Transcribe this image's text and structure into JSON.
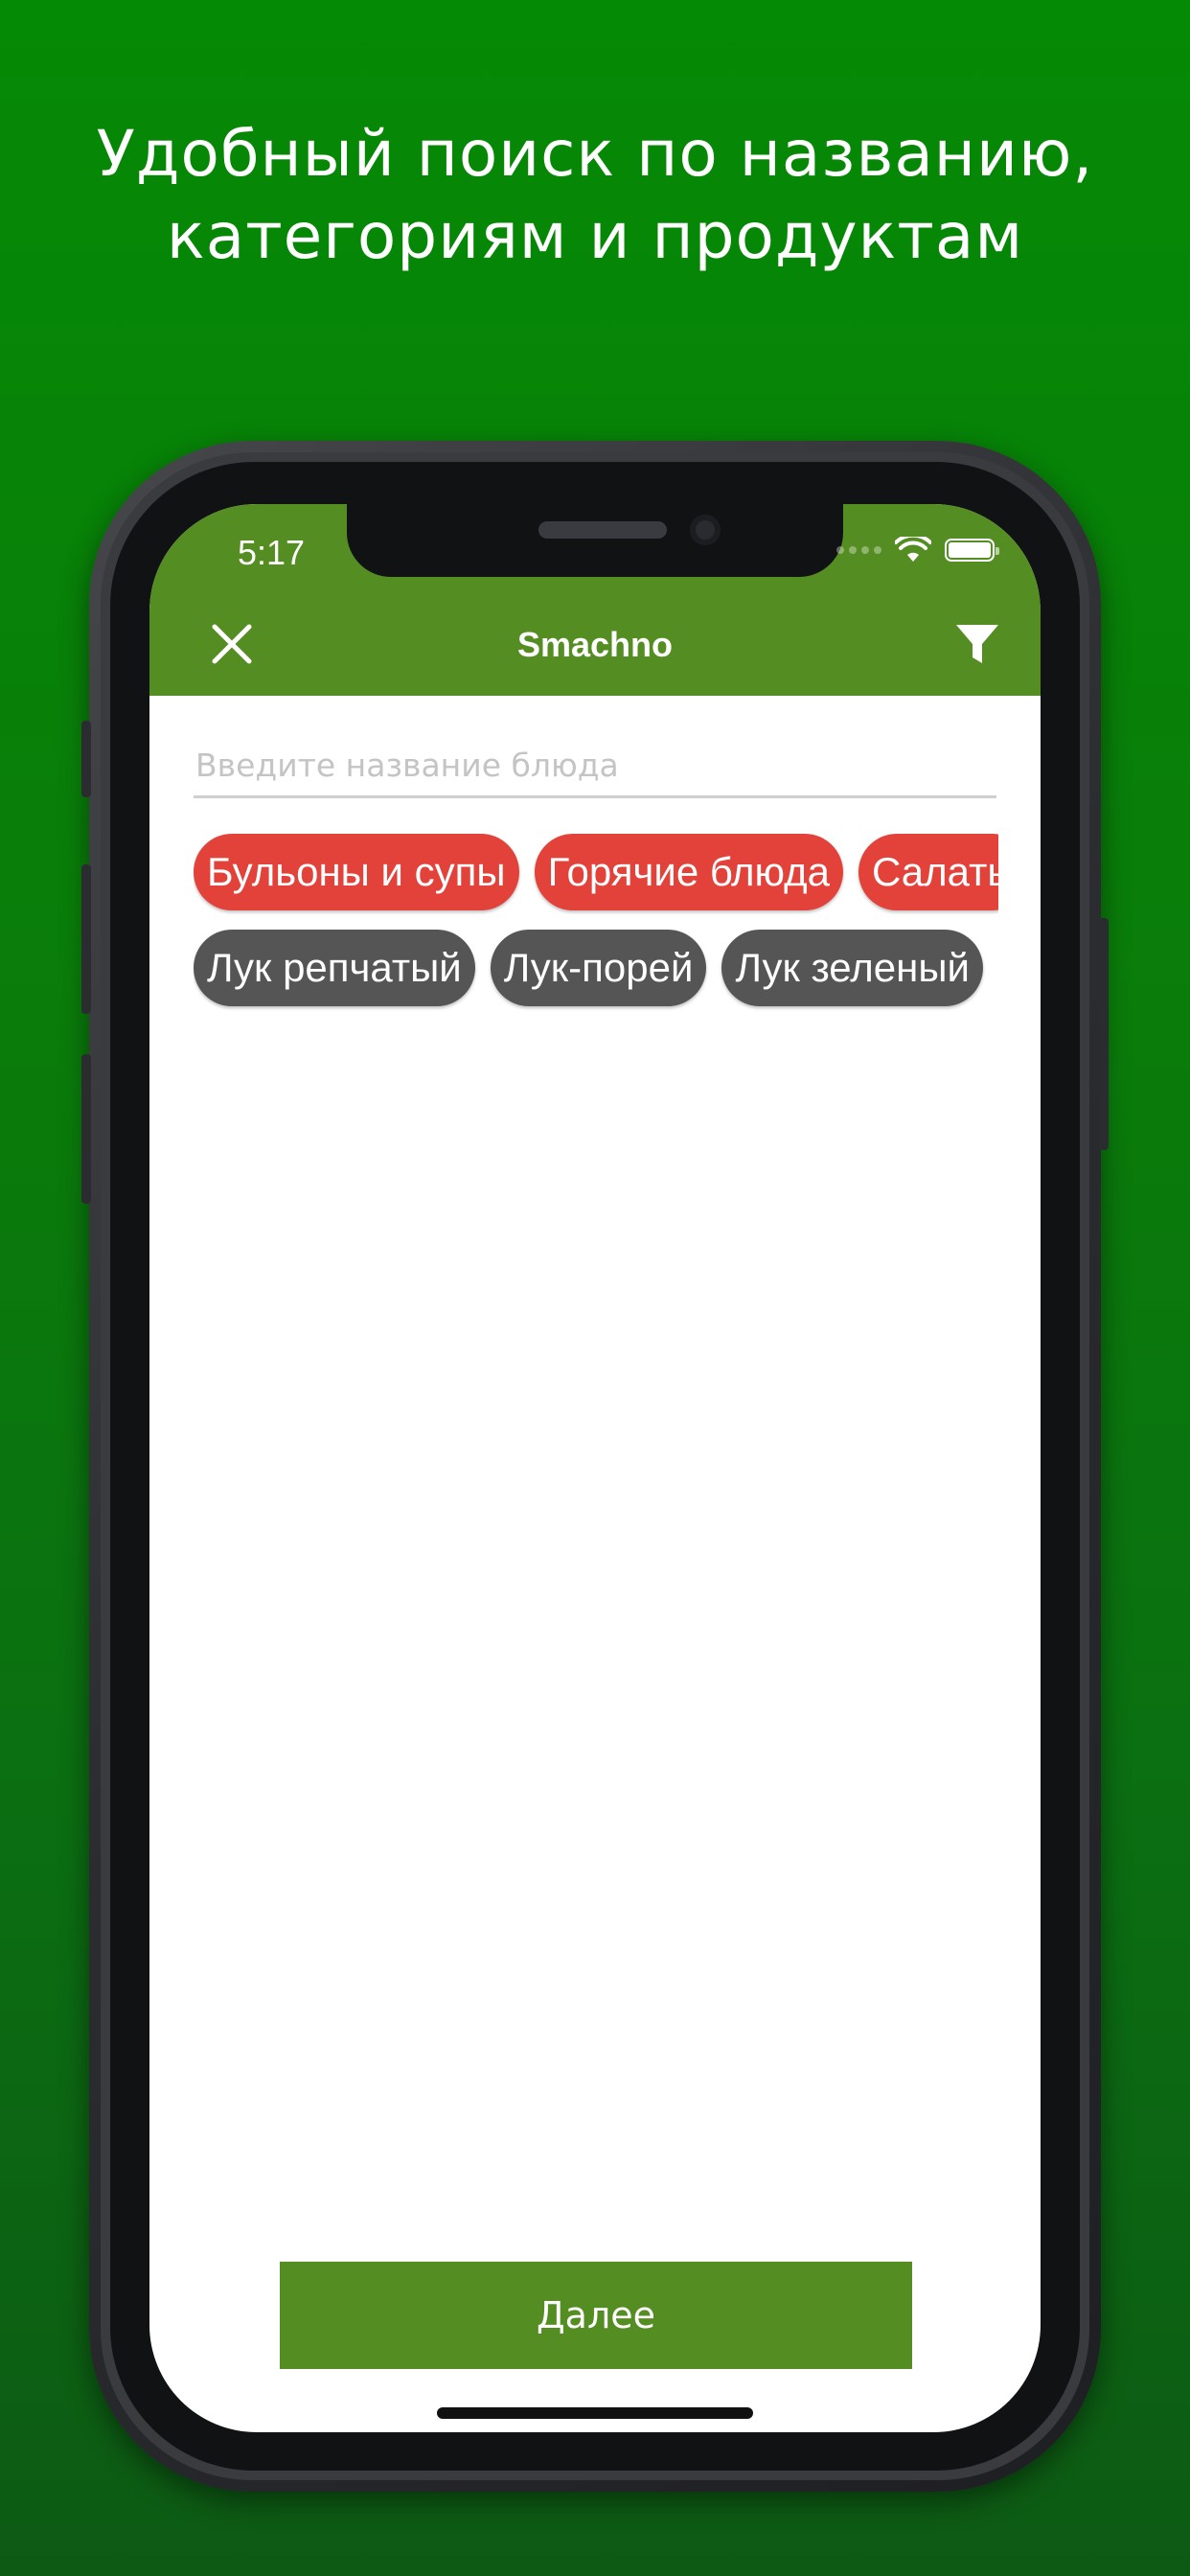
{
  "promo": {
    "line1": "Удобный поиск по названию,",
    "line2": "категориям и продуктам"
  },
  "status_bar": {
    "time": "5:17"
  },
  "app_bar": {
    "title": "Smachno",
    "close_icon": "close-icon",
    "filter_icon": "filter-icon"
  },
  "search": {
    "placeholder": "Введите название блюда",
    "value": ""
  },
  "categories": [
    "Бульоны и супы",
    "Горячие блюда",
    "Салаты"
  ],
  "products": [
    "Лук репчатый",
    "Лук-порей",
    "Лук зеленый"
  ],
  "next_button": {
    "label": "Далее"
  },
  "colors": {
    "background": "#058a05",
    "app_bar": "#548d21",
    "category_chip": "#e2423a",
    "product_chip": "#555555",
    "button": "#548d21"
  }
}
